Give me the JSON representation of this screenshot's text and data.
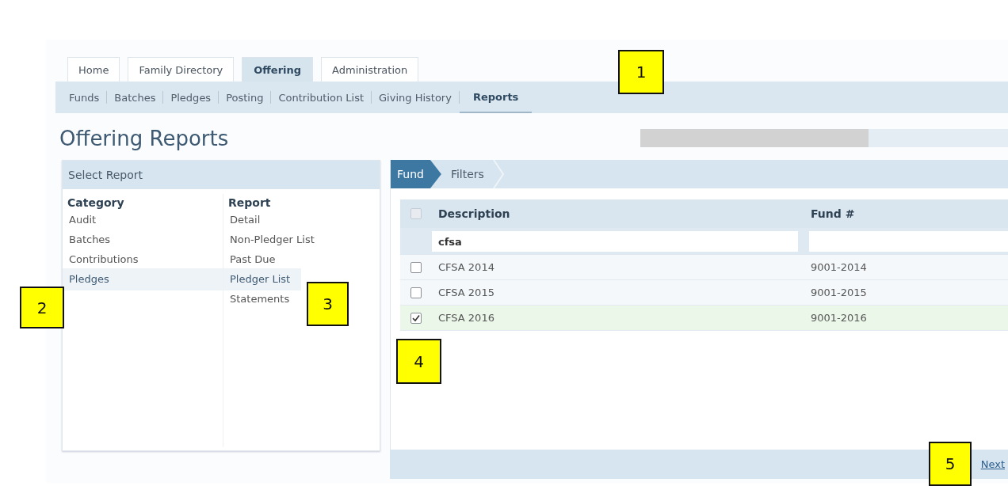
{
  "tabs": [
    {
      "label": "Home",
      "selected": false
    },
    {
      "label": "Family Directory",
      "selected": false
    },
    {
      "label": "Offering",
      "selected": true
    },
    {
      "label": "Administration",
      "selected": false
    }
  ],
  "subnav": [
    {
      "label": "Funds",
      "selected": false
    },
    {
      "label": "Batches",
      "selected": false
    },
    {
      "label": "Pledges",
      "selected": false
    },
    {
      "label": "Posting",
      "selected": false
    },
    {
      "label": "Contribution List",
      "selected": false
    },
    {
      "label": "Giving History",
      "selected": false
    },
    {
      "label": "Reports",
      "selected": true
    }
  ],
  "page_title": "Offering Reports",
  "select_report": {
    "title": "Select Report",
    "category_header": "Category",
    "report_header": "Report",
    "categories": [
      {
        "label": "Audit",
        "selected": false
      },
      {
        "label": "Batches",
        "selected": false
      },
      {
        "label": "Contributions",
        "selected": false
      },
      {
        "label": "Pledges",
        "selected": true
      }
    ],
    "reports": [
      {
        "label": "Detail",
        "selected": false
      },
      {
        "label": "Non-Pledger List",
        "selected": false
      },
      {
        "label": "Past Due",
        "selected": false
      },
      {
        "label": "Pledger List",
        "selected": true
      },
      {
        "label": "Statements",
        "selected": false
      }
    ]
  },
  "wizard": {
    "steps": [
      {
        "label": "Fund",
        "selected": true
      },
      {
        "label": "Filters",
        "selected": false
      }
    ],
    "columns": [
      "Description",
      "Fund #"
    ],
    "select_all_checked": false,
    "description_filter": "cfsa",
    "rows": [
      {
        "description": "CFSA 2014",
        "fund_number": "9001-2014",
        "checked": false
      },
      {
        "description": "CFSA 2015",
        "fund_number": "9001-2015",
        "checked": false
      },
      {
        "description": "CFSA 2016",
        "fund_number": "9001-2016",
        "checked": true
      }
    ],
    "next_link": "Next"
  },
  "callouts": [
    "1",
    "2",
    "3",
    "4",
    "5"
  ]
}
